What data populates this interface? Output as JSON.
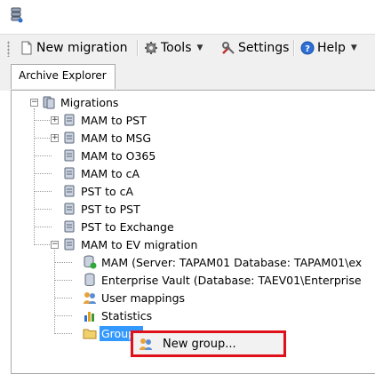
{
  "toolbar": {
    "new_migration": "New migration",
    "tools": "Tools",
    "settings": "Settings",
    "help": "Help"
  },
  "tabs": {
    "archive_explorer": "Archive Explorer"
  },
  "tree": {
    "root": "Migrations",
    "items": [
      "MAM to PST",
      "MAM to MSG",
      "MAM to O365",
      "MAM to cA",
      "PST to cA",
      "PST to PST",
      "PST to Exchange",
      "MAM to EV migration"
    ],
    "children": [
      "MAM (Server: TAPAM01 Database: TAPAM01\\ex",
      "Enterprise Vault (Database: TAEV01\\Enterprise",
      "User mappings",
      "Statistics",
      "Groups"
    ]
  },
  "context_menu": {
    "new_group": "New group..."
  },
  "colors": {
    "selection": "#3399ff",
    "highlight_border": "#e0101a"
  }
}
